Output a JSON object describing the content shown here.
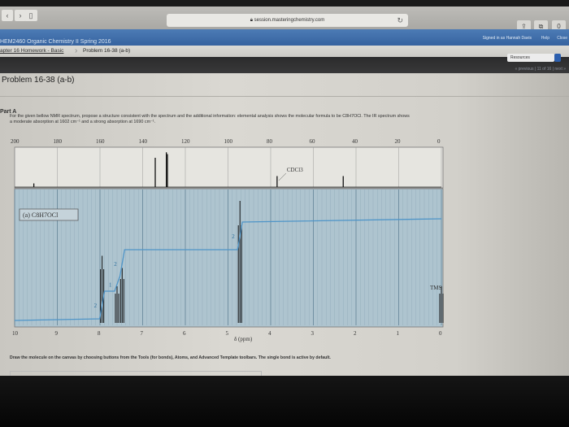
{
  "browser": {
    "url": "session.masteringchemistry.com"
  },
  "header": {
    "course": "HEM2460 Organic Chemistry II Spring 2016",
    "signed_in": "Signed in as Hannah Davis",
    "help": "Help",
    "close": "Close"
  },
  "breadcrumb": {
    "assignment": "apter 16 Homework - Basic",
    "problem": "Problem 16-38 (a-b)"
  },
  "nav": {
    "resources": "Resources",
    "pager": "« previous | 11 of 16 | next »"
  },
  "page": {
    "title": "Problem 16-38 (a-b)",
    "part": "Part A",
    "instruction_line1": "For the given bellow NMR spectrum, propose a structure consistent with the spectrum and the additional information: elemental analysis shows the molecular formula to be C8H7OCl. The IR spectrum shows",
    "instruction_line2": "a moderate absorption at 1602 cm⁻¹ and a strong absorption at 1690 cm⁻¹.",
    "draw_instruction": "Draw the molecule on the canvas by choosing buttons from the Tools (for bonds), Atoms, and Advanced Template toolbars. The single bond is active by default."
  },
  "chart_data": [
    {
      "type": "line",
      "title": "13C NMR",
      "xlim": [
        200,
        0
      ],
      "ticks": [
        "200",
        "180",
        "160",
        "140",
        "120",
        "100",
        "80",
        "60",
        "40",
        "20",
        "0"
      ],
      "peaks": [
        {
          "ppm": 191,
          "h": 0.1
        },
        {
          "ppm": 134.1,
          "h": 0.8
        },
        {
          "ppm": 128.9,
          "h": 0.95
        },
        {
          "ppm": 128.4,
          "h": 0.9
        },
        {
          "ppm": 77,
          "h": 0.3,
          "label": "CDCl3"
        },
        {
          "ppm": 46,
          "h": 0.3
        }
      ]
    },
    {
      "type": "line",
      "title": "1H NMR",
      "sample_label": "(a) C8H7OCl",
      "xlabel": "δ (ppm)",
      "xlim": [
        10,
        0
      ],
      "ticks": [
        "10",
        "9",
        "8",
        "7",
        "6",
        "5",
        "4",
        "3",
        "2",
        "1",
        "0"
      ],
      "peaks": [
        {
          "ppm": 7.95,
          "h": 0.55,
          "integral": "2"
        },
        {
          "ppm": 7.6,
          "h": 0.3,
          "integral": "1"
        },
        {
          "ppm": 7.48,
          "h": 0.45,
          "integral": "2"
        },
        {
          "ppm": 4.72,
          "h": 1.0,
          "integral": "2"
        },
        {
          "ppm": 0,
          "h": 0.3,
          "label": "TMS"
        }
      ]
    }
  ]
}
